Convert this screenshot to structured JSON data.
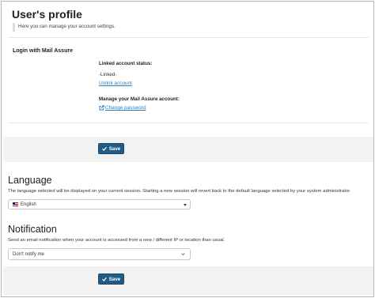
{
  "profile": {
    "title": "User's profile",
    "subtitle": "Here you can manage your account settings."
  },
  "login": {
    "section_label": "Login with Mail Assure",
    "linked_status_label": "Linked account status:",
    "linked_status_value": "-Linked-",
    "unlink_label": "Unlink account",
    "manage_label": "Manage your Mail Assure account:",
    "change_password_label": "Change password",
    "change_password_icon": "external-link-icon"
  },
  "buttons": {
    "save_label": "Save",
    "save_icon": "check-icon"
  },
  "language": {
    "heading": "Language",
    "description": "The language selected will be displayed on your current session. Starting a new session will revert back to the default language selected by your system administrator.",
    "selected": "English",
    "selected_icon": "uk-flag-icon"
  },
  "notification": {
    "heading": "Notification",
    "description": "Send an email notification when your account is accessed from a new / different IP or location than usual.",
    "selected": "Don't notify me"
  },
  "colors": {
    "button_bg": "#1f5d86",
    "link": "#2e7fc0",
    "band_bg": "#f2f2f2"
  }
}
